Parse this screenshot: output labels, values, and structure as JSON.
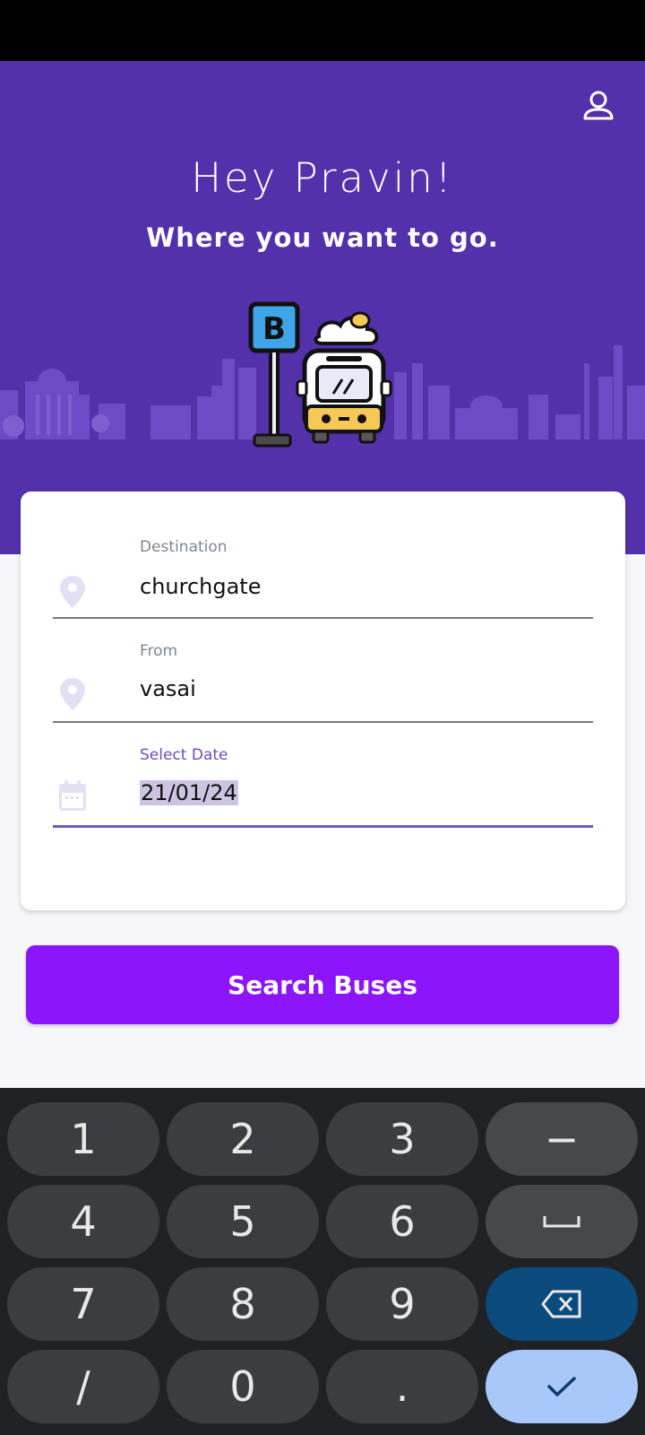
{
  "header": {
    "greeting": "Hey Pravin!",
    "subtitle": "Where you want to go.",
    "profile_icon": "person-outline-icon",
    "background_color": "#5331ab"
  },
  "form": {
    "destination": {
      "label": "Destination",
      "value": "churchgate",
      "icon": "location-pin-icon"
    },
    "from": {
      "label": "From",
      "value": "vasai",
      "icon": "location-pin-icon"
    },
    "date": {
      "label": "Select Date",
      "value": "21/01/24",
      "icon": "calendar-icon"
    }
  },
  "search_button": {
    "label": "Search Buses",
    "color": "#8c16fb"
  },
  "keyboard": {
    "type": "numeric",
    "keys": {
      "k1": "1",
      "k2": "2",
      "k3": "3",
      "minus": "−",
      "k4": "4",
      "k5": "5",
      "k6": "6",
      "k7": "7",
      "k8": "8",
      "k9": "9",
      "slash": "/",
      "k0": "0",
      "dot": "."
    },
    "special_keys": [
      "space-icon",
      "backspace-icon",
      "checkmark-icon"
    ]
  }
}
